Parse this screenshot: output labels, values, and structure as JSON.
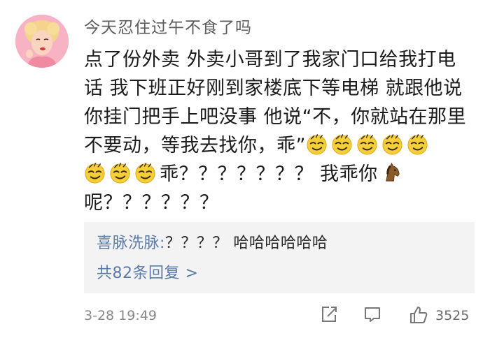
{
  "comment": {
    "username": "今天忍住过午不食了吗",
    "lines": [
      "点了份外卖 外卖小哥到了我家门口给我打电",
      "话 我下班正好刚到家楼底下等电梯 就跟他说",
      "你挂门把手上吧没事 他说“不，你就站在那里",
      "不要动，等我去找你，乖”",
      "乖？？？？？？？ 我乖你",
      "呢？？？？？？"
    ],
    "emoji_names": [
      "smirk-face-emoji",
      "horse-emoji"
    ],
    "date": "3-28 19:49",
    "likes": "3525"
  },
  "reply": {
    "user": "喜脉洗脉:",
    "text": "？？？？ 哈哈哈哈哈哈",
    "more": "共82条回复 >"
  },
  "colors": {
    "link": "#5b7ca6",
    "reply_bg": "#f3f3f3",
    "meta": "#888888"
  }
}
